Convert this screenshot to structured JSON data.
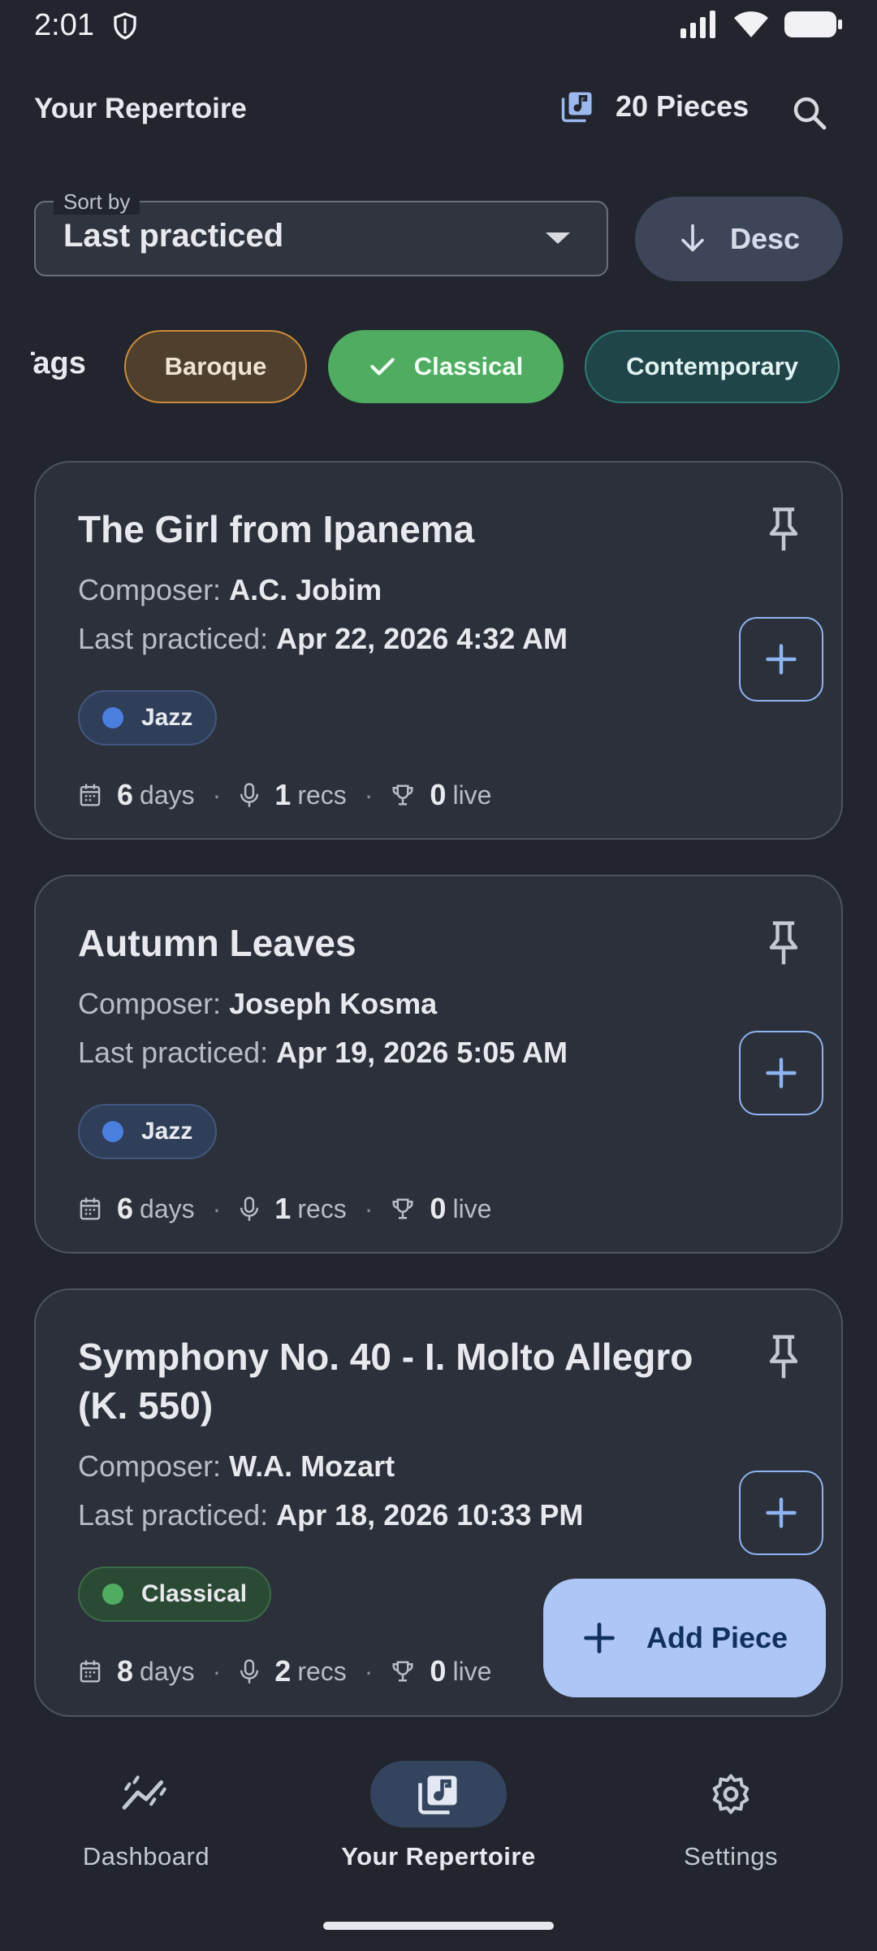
{
  "status": {
    "time": "2:01"
  },
  "header": {
    "title": "Your Repertoire",
    "pieces_count": "20 Pieces"
  },
  "sort": {
    "label": "Sort by",
    "value": "Last practiced",
    "order_label": "Desc"
  },
  "tags": {
    "label": "Tags",
    "chips": [
      {
        "label": "Baroque",
        "selected": false
      },
      {
        "label": "Classical",
        "selected": true
      },
      {
        "label": "Contemporary",
        "selected": false
      }
    ]
  },
  "pieces": [
    {
      "title": "The Girl from Ipanema",
      "composer_label": "Composer:",
      "composer": "A.C. Jobim",
      "practiced_label": "Last practiced:",
      "last_practiced": "Apr 22, 2026 4:32 AM",
      "tag": "Jazz",
      "tag_color": "#4a7fe0",
      "days": "6",
      "days_unit": "days",
      "recs": "1",
      "recs_unit": "recs",
      "live": "0",
      "live_unit": "live"
    },
    {
      "title": "Autumn Leaves",
      "composer_label": "Composer:",
      "composer": "Joseph Kosma",
      "practiced_label": "Last practiced:",
      "last_practiced": "Apr 19, 2026 5:05 AM",
      "tag": "Jazz",
      "tag_color": "#4a7fe0",
      "days": "6",
      "days_unit": "days",
      "recs": "1",
      "recs_unit": "recs",
      "live": "0",
      "live_unit": "live"
    },
    {
      "title_line1": "Symphony No. 40 - I. Molto Allegro",
      "title_line2": "(K. 550)",
      "composer_label": "Composer:",
      "composer": "W.A. Mozart",
      "practiced_label": "Last practiced:",
      "last_practiced": "Apr 18, 2026 10:33 PM",
      "tag": "Classical",
      "tag_color": "#4fac61",
      "days": "8",
      "days_unit": "days",
      "recs": "2",
      "recs_unit": "recs",
      "live": "0",
      "live_unit": "live"
    }
  ],
  "fab": {
    "label": "Add Piece"
  },
  "nav": [
    {
      "label": "Dashboard",
      "icon": "chart-line-icon"
    },
    {
      "label": "Your Repertoire",
      "icon": "music-library-icon",
      "active": true
    },
    {
      "label": "Settings",
      "icon": "gear-icon"
    }
  ],
  "colors": {
    "accent": "#adc6f5",
    "background": "#22252d",
    "card": "#2c303a",
    "classical": "#4fac61"
  }
}
